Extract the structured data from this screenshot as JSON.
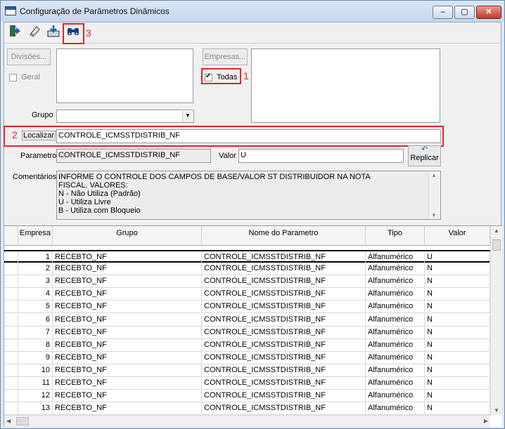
{
  "window": {
    "title": "Configuração de Parâmetros Dinâmicos",
    "min": "‒",
    "max": "▢",
    "close": "✕"
  },
  "toolbar": {
    "icons": [
      "exit-icon",
      "eraser-icon",
      "save-download-icon",
      "binoculars-icon"
    ],
    "annotation": "3"
  },
  "divisoes": {
    "button": "Divisões...",
    "geral_label": "Geral"
  },
  "empresas": {
    "button": "Empresas...",
    "todas_label": "Todas",
    "todas_checked": true,
    "annotation": "1"
  },
  "grupo": {
    "label": "Grupo",
    "value": ""
  },
  "localizar": {
    "label": "Localizar",
    "value": "CONTROLE_ICMSSTDISTRIB_NF",
    "annotation": "2"
  },
  "parametro": {
    "label": "Parametro",
    "value": "CONTROLE_ICMSSTDISTRIB_NF"
  },
  "valor": {
    "label": "Valor",
    "value": "U"
  },
  "replicar": {
    "label": "Replicar"
  },
  "comentarios": {
    "label": "Comentários",
    "lines": [
      "INFORME O CONTROLE DOS CAMPOS DE BASE/VALOR ST DISTRIBUIDOR NA NOTA",
      "FISCAL. VALORES:",
      "N - Não Utiliza (Padrão)",
      "U - Utiliza Livre",
      "B - Utiliza com Bloqueio"
    ]
  },
  "grid": {
    "columns": [
      "Empresa",
      "Grupo",
      "Nome do Parametro",
      "Tipo",
      "Valor"
    ],
    "rows": [
      [
        "1",
        "RECEBTO_NF",
        "CONTROLE_ICMSSTDISTRIB_NF",
        "Alfanumérico",
        "U"
      ],
      [
        "2",
        "RECEBTO_NF",
        "CONTROLE_ICMSSTDISTRIB_NF",
        "Alfanumérico",
        "N"
      ],
      [
        "3",
        "RECEBTO_NF",
        "CONTROLE_ICMSSTDISTRIB_NF",
        "Alfanumérico",
        "N"
      ],
      [
        "4",
        "RECEBTO_NF",
        "CONTROLE_ICMSSTDISTRIB_NF",
        "Alfanumérico",
        "N"
      ],
      [
        "5",
        "RECEBTO_NF",
        "CONTROLE_ICMSSTDISTRIB_NF",
        "Alfanumérico",
        "N"
      ],
      [
        "6",
        "RECEBTO_NF",
        "CONTROLE_ICMSSTDISTRIB_NF",
        "Alfanumérico",
        "N"
      ],
      [
        "7",
        "RECEBTO_NF",
        "CONTROLE_ICMSSTDISTRIB_NF",
        "Alfanumérico",
        "N"
      ],
      [
        "8",
        "RECEBTO_NF",
        "CONTROLE_ICMSSTDISTRIB_NF",
        "Alfanumérico",
        "N"
      ],
      [
        "9",
        "RECEBTO_NF",
        "CONTROLE_ICMSSTDISTRIB_NF",
        "Alfanumérico",
        "N"
      ],
      [
        "10",
        "RECEBTO_NF",
        "CONTROLE_ICMSSTDISTRIB_NF",
        "Alfanumérico",
        "N"
      ],
      [
        "11",
        "RECEBTO_NF",
        "CONTROLE_ICMSSTDISTRIB_NF",
        "Alfanumérico",
        "N"
      ],
      [
        "12",
        "RECEBTO_NF",
        "CONTROLE_ICMSSTDISTRIB_NF",
        "Alfanumérico",
        "N"
      ],
      [
        "13",
        "RECEBTO_NF",
        "CONTROLE_ICMSSTDISTRIB_NF",
        "Alfanumérico",
        "N"
      ]
    ]
  },
  "colors": {
    "annotation": "#e0252b",
    "accent": "#2b5aa8"
  }
}
